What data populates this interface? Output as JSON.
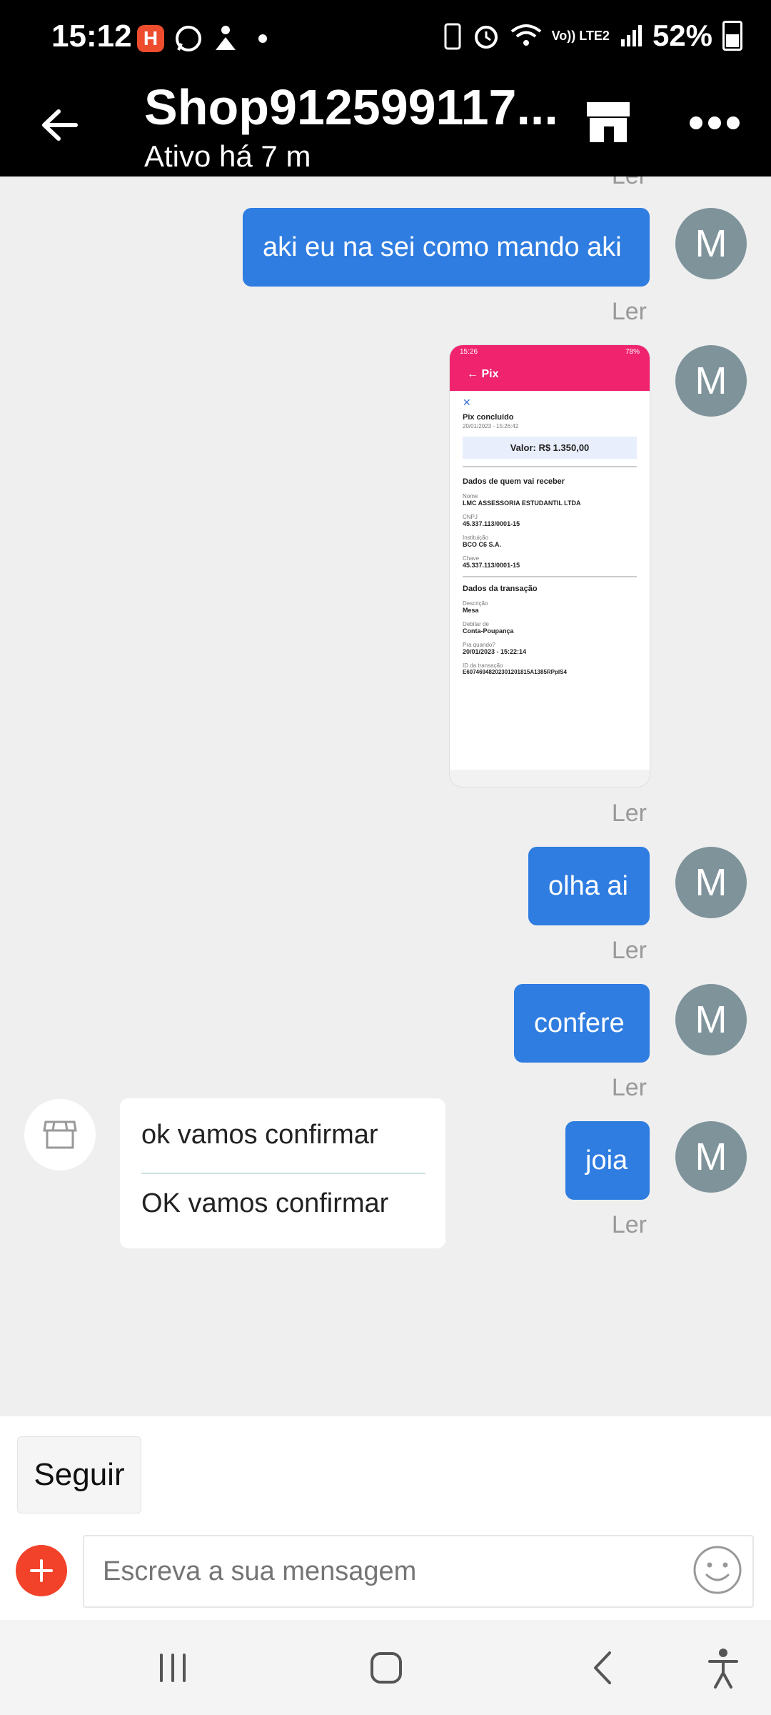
{
  "status_bar": {
    "time": "15:12",
    "network": "Vo)) LTE2",
    "battery": "52%",
    "icons": [
      "shopee-app-icon",
      "whatsapp-icon",
      "upload-icon",
      "dot-icon",
      "recycle-battery-icon",
      "alarm-icon",
      "wifi-icon",
      "signal-icon",
      "battery-icon"
    ]
  },
  "header": {
    "title": "Shop912599117...",
    "subtitle": "Ativo há 7 m",
    "icons": [
      "back-arrow-icon",
      "store-icon",
      "more-dots-icon"
    ]
  },
  "chat": {
    "top_partial_read": "Ler",
    "messages": [
      {
        "type": "text",
        "text": "aki eu na sei como mando aki",
        "status": "Ler",
        "avatar": "M"
      },
      {
        "type": "image",
        "status": "Ler",
        "avatar": "M",
        "image": {
          "status_time": "15:26",
          "status_battery": "78%",
          "screen_title": "Pix",
          "heading": "Pix concluído",
          "heading_date": "20/01/2023 - 15:26:42",
          "value": "Valor: R$ 1.350,00",
          "section1": "Dados de quem vai receber",
          "name_label": "Nome",
          "name": "LMC ASSESSORIA ESTUDANTIL LTDA",
          "cnpj_label": "CNPJ",
          "cnpj": "45.337.113/0001-15",
          "inst_label": "Instituição",
          "inst": "BCO C6 S.A.",
          "key_label": "Chave",
          "key": "45.337.113/0001-15",
          "section2": "Dados da transação",
          "desc_label": "Descrição",
          "desc": "Mesa",
          "debit_label": "Debitar de",
          "debit": "Conta-Poupança",
          "when_label": "Pra quando?",
          "when": "20/01/2023 - 15:22:14",
          "id_label": "ID da transação",
          "id": "E60746948202301201815A1385RPpIS4"
        }
      },
      {
        "type": "text",
        "text": "olha ai",
        "status": "Ler",
        "avatar": "M"
      },
      {
        "type": "text",
        "text": "confere",
        "status": "Ler",
        "avatar": "M"
      },
      {
        "type": "text",
        "text": "joia",
        "status": "Ler",
        "avatar": "M"
      }
    ],
    "incoming": {
      "avatar_icon": "store-awning-icon",
      "lines": [
        "ok vamos confirmar",
        "OK vamos confirmar"
      ]
    }
  },
  "footer": {
    "follow_label": "Seguir",
    "input_placeholder": "Escreva a sua mensagem"
  },
  "colors": {
    "bubble": "#2f7de1",
    "avatar": "#7f939b",
    "plus": "#f2422a",
    "pix_header": "#f0236f"
  }
}
